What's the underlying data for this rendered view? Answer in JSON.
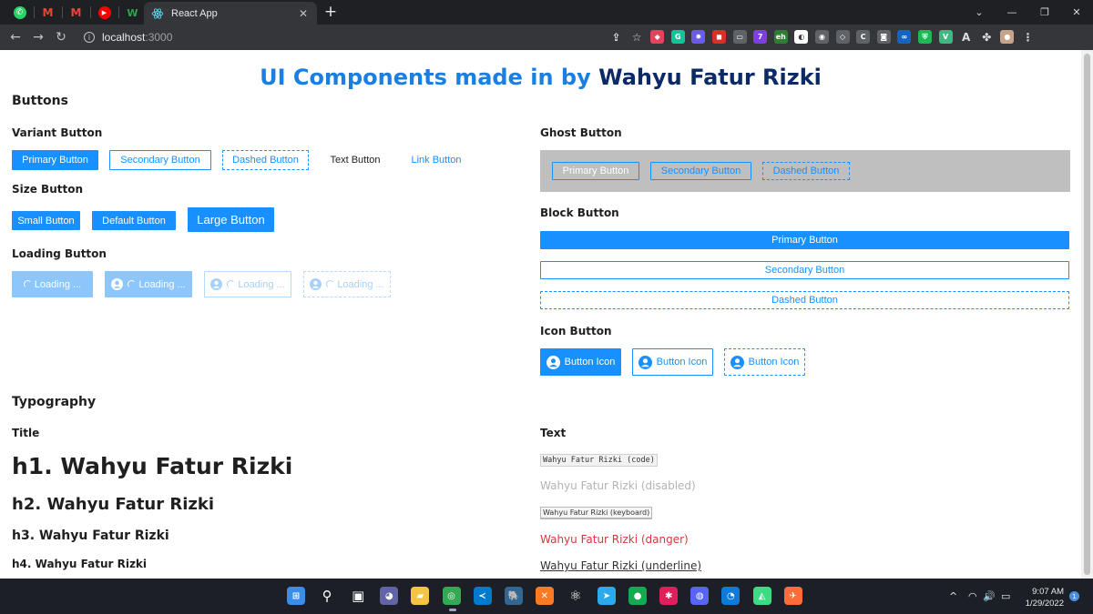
{
  "browser": {
    "tab_title": "React App",
    "close_glyph": "✕",
    "new_tab_glyph": "+",
    "url_host": "localhost",
    "url_port": ":3000",
    "pinned_tabs": [
      {
        "icon": "whatsapp-icon",
        "glyph": "✆",
        "color": "#25d366"
      },
      {
        "icon": "gmail-icon",
        "glyph": "M",
        "color": "#ea4335"
      },
      {
        "icon": "gmail-icon",
        "glyph": "M",
        "color": "#ea4335"
      },
      {
        "icon": "youtube-music-icon",
        "glyph": "▶",
        "color": "#ff0000"
      },
      {
        "icon": "webflow-icon",
        "glyph": "W",
        "color": "#2ea44f"
      }
    ],
    "window_controls": {
      "menu": "⌄",
      "minimize": "—",
      "maximize": "❐",
      "close": "✕"
    },
    "nav": {
      "back": "←",
      "forward": "→",
      "reload": "↻",
      "info": "i"
    },
    "extensions": [
      {
        "name": "share-icon",
        "glyph": "⇪",
        "color": "transparent"
      },
      {
        "name": "bookmark-star-icon",
        "glyph": "☆",
        "color": "transparent"
      },
      {
        "name": "extension-colorful-icon",
        "glyph": "◆",
        "color": "#e2445c"
      },
      {
        "name": "grammarly-icon",
        "glyph": "G",
        "color": "#15c39a"
      },
      {
        "name": "extension-gear-icon",
        "glyph": "✹",
        "color": "#6b5ce7"
      },
      {
        "name": "extension-red-icon",
        "glyph": "◼",
        "color": "#d93025"
      },
      {
        "name": "extension-window-icon",
        "glyph": "▭",
        "color": "#5f6368"
      },
      {
        "name": "extension-purple-icon",
        "glyph": "7",
        "color": "#7b3fe4"
      },
      {
        "name": "extension-eh-icon",
        "glyph": "eh",
        "color": "#2e7d32"
      },
      {
        "name": "extension-compass-icon",
        "glyph": "◐",
        "color": "#ffffff"
      },
      {
        "name": "extension-circle-icon",
        "glyph": "◉",
        "color": "#5f6368"
      },
      {
        "name": "extension-tag-icon",
        "glyph": "◇",
        "color": "#5f6368"
      },
      {
        "name": "extension-c-icon",
        "glyph": "C",
        "color": "#5f6368"
      },
      {
        "name": "extension-camera-icon",
        "glyph": "◙",
        "color": "#5f6368"
      },
      {
        "name": "extension-infinity-icon",
        "glyph": "∞",
        "color": "#1565c0"
      },
      {
        "name": "extension-shield-icon",
        "glyph": "⛨",
        "color": "#1db954"
      },
      {
        "name": "vue-devtools-icon",
        "glyph": "V",
        "color": "#41b883"
      },
      {
        "name": "extension-a-icon",
        "glyph": "A",
        "color": "#35363a"
      },
      {
        "name": "extensions-puzzle-icon",
        "glyph": "✤",
        "color": "#35363a"
      },
      {
        "name": "profile-avatar-icon",
        "glyph": "●",
        "color": "#c8a28a"
      },
      {
        "name": "menu-kebab-icon",
        "glyph": "⋮",
        "color": "#35363a"
      }
    ]
  },
  "page": {
    "title_accent": "UI Components made in by",
    "title_name": "Wahyu Fatur Rizki",
    "buttons_heading": "Buttons",
    "variant": {
      "heading": "Variant Button",
      "primary": "Primary Button",
      "secondary": "Secondary Button",
      "dashed": "Dashed Button",
      "text": "Text Button",
      "link": "Link Button"
    },
    "size": {
      "heading": "Size Button",
      "small": "Small Button",
      "default": "Default Button",
      "large": "Large Button"
    },
    "loading": {
      "heading": "Loading Button",
      "labels": [
        "Loading ...",
        "Loading ...",
        "Loading ...",
        "Loading ..."
      ]
    },
    "ghost": {
      "heading": "Ghost Button",
      "primary": "Primary Button",
      "secondary": "Secondary Button",
      "dashed": "Dashed Button"
    },
    "block": {
      "heading": "Block Button",
      "primary": "Primary Button",
      "secondary": "Secondary Button",
      "dashed": "Dashed Button"
    },
    "icon_btn": {
      "heading": "Icon Button",
      "labels": [
        "Button Icon",
        "Button Icon",
        "Button Icon"
      ]
    },
    "typography_heading": "Typography",
    "title_section": {
      "heading": "Title",
      "h1": "h1. Wahyu Fatur Rizki",
      "h2": "h2. Wahyu Fatur Rizki",
      "h3": "h3. Wahyu Fatur Rizki",
      "h4": "h4. Wahyu Fatur Rizki"
    },
    "text_section": {
      "heading": "Text",
      "code": "Wahyu Fatur Rizki (code)",
      "disabled": "Wahyu Fatur Rizki (disabled)",
      "keyboard": "Wahyu Fatur Rizki (keyboard)",
      "danger": "Wahyu Fatur Rizki (danger)",
      "underline": "Wahyu Fatur Rizki (underline)"
    }
  },
  "taskbar": {
    "apps": [
      {
        "name": "start-windows-icon",
        "glyph": "⊞",
        "color": "#3b8ee8"
      },
      {
        "name": "search-icon",
        "glyph": "⚲",
        "color": "transparent"
      },
      {
        "name": "task-view-icon",
        "glyph": "▣",
        "color": "transparent"
      },
      {
        "name": "teams-chat-icon",
        "glyph": "◕",
        "color": "#6264a7"
      },
      {
        "name": "file-explorer-icon",
        "glyph": "▰",
        "color": "#f4c542"
      },
      {
        "name": "chrome-icon",
        "glyph": "◎",
        "color": "#34a853"
      },
      {
        "name": "vscode-icon",
        "glyph": "≺",
        "color": "#007acc"
      },
      {
        "name": "postgres-icon",
        "glyph": "🐘",
        "color": "#336791"
      },
      {
        "name": "xampp-icon",
        "glyph": "✕",
        "color": "#fb7a24"
      },
      {
        "name": "react-devtools-icon",
        "glyph": "⚛",
        "color": "transparent"
      },
      {
        "name": "telegram-icon",
        "glyph": "➤",
        "color": "#2aabee"
      },
      {
        "name": "mongodb-icon",
        "glyph": "●",
        "color": "#13aa52"
      },
      {
        "name": "slack-icon",
        "glyph": "✱",
        "color": "#e01e5a"
      },
      {
        "name": "discord-icon",
        "glyph": "◍",
        "color": "#5865f2"
      },
      {
        "name": "edge-icon",
        "glyph": "◔",
        "color": "#0f7bd8"
      },
      {
        "name": "android-studio-icon",
        "glyph": "◭",
        "color": "#3ddc84"
      },
      {
        "name": "postman-icon",
        "glyph": "✈",
        "color": "#ff6c37"
      }
    ],
    "tray": {
      "chevron": "^",
      "wifi": "◠",
      "volume": "🔊",
      "battery": "▭"
    },
    "time": "9:07 AM",
    "date": "1/29/2022",
    "notification_count": "1"
  }
}
